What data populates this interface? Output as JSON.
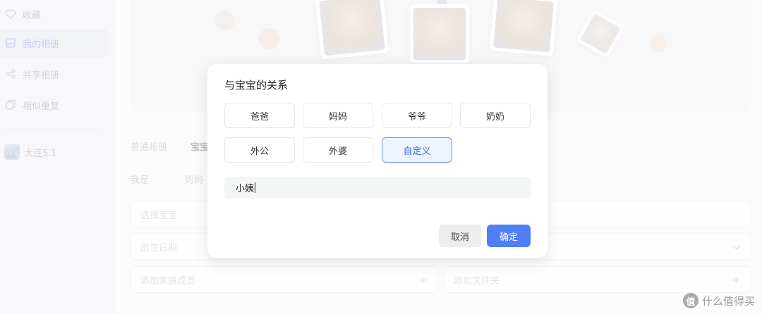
{
  "sidebar": {
    "items": [
      {
        "label": "收藏",
        "icon": "heart-icon",
        "active": false
      },
      {
        "label": "我的相册",
        "icon": "album-icon",
        "active": true
      },
      {
        "label": "共享相册",
        "icon": "share-icon",
        "active": false
      },
      {
        "label": "相似重复",
        "icon": "duplicate-icon",
        "active": false
      }
    ],
    "album": {
      "label": "大连5.1",
      "icon": "album-thumbnail"
    }
  },
  "main": {
    "tabs": [
      "普通相册",
      "宝宝"
    ],
    "me_label": "我是",
    "me_value": "妈妈",
    "fields": {
      "select_baby": "选择宝宝",
      "birth_date": "出生日期",
      "add_family": "添加家庭成员",
      "add_folder": "添加文件夹"
    }
  },
  "dialog": {
    "title": "与宝宝的关系",
    "options": [
      "爸爸",
      "妈妈",
      "爷爷",
      "奶奶",
      "外公",
      "外婆",
      "自定义"
    ],
    "selected": "自定义",
    "custom_value": "小姨",
    "cancel_label": "取消",
    "confirm_label": "确定"
  },
  "watermark": {
    "badge": "值",
    "text": "什么值得买"
  },
  "colors": {
    "accent": "#4f7ef5",
    "selected_bg": "#eef3fe",
    "selected_border": "#6c90f0"
  }
}
